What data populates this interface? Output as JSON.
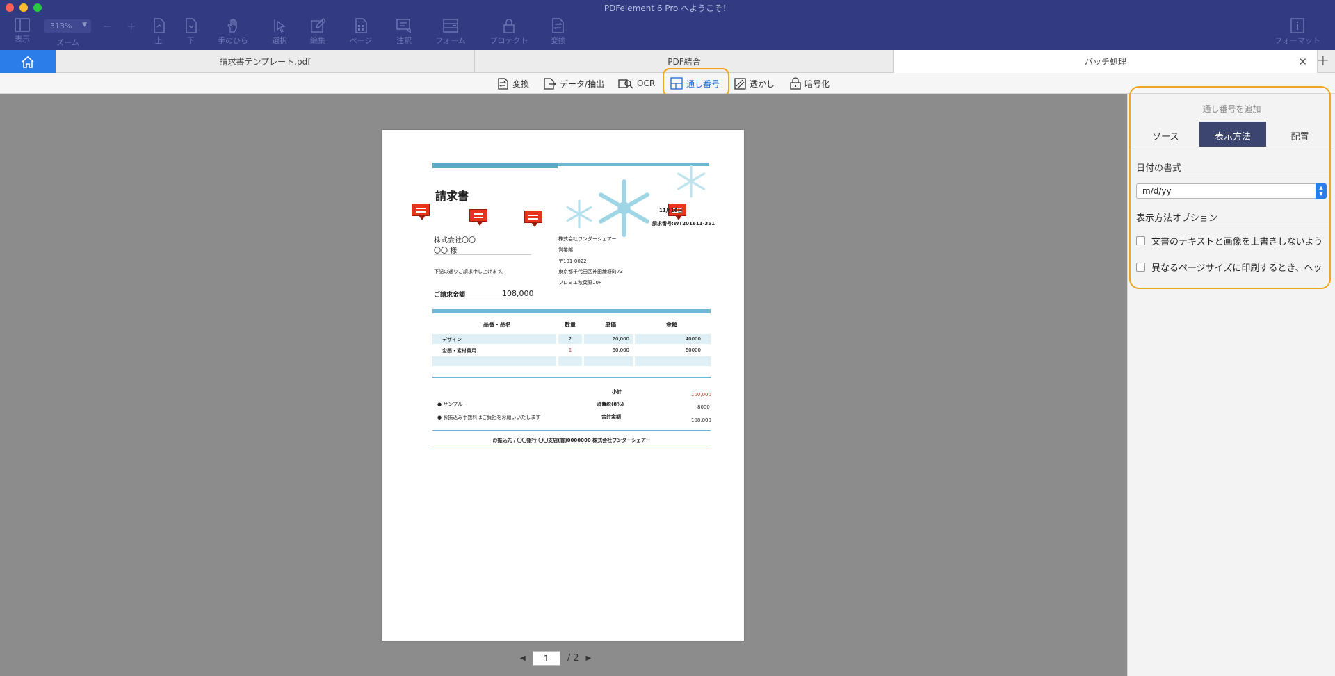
{
  "app": {
    "title": "PDFelement 6 Pro へようこそ！"
  },
  "colors": {
    "toolbar_bg": "#323b82",
    "accent_blue": "#2b7de9",
    "highlight": "#f0a520",
    "active_tab": "#3c4470"
  },
  "toolbar": {
    "zoom_value": "313%",
    "zoom_label": "ズーム",
    "tools": [
      {
        "label": "表示",
        "icon": "sidebar-icon"
      },
      {
        "label": "上",
        "icon": "page-up-icon"
      },
      {
        "label": "下",
        "icon": "page-down-icon"
      },
      {
        "label": "手のひら",
        "icon": "hand-icon"
      },
      {
        "label": "選択",
        "icon": "cursor-icon"
      },
      {
        "label": "編集",
        "icon": "edit-icon"
      },
      {
        "label": "ページ",
        "icon": "page-icon"
      },
      {
        "label": "注釈",
        "icon": "comment-icon"
      },
      {
        "label": "フォーム",
        "icon": "form-icon"
      },
      {
        "label": "プロテクト",
        "icon": "lock-icon"
      },
      {
        "label": "変換",
        "icon": "convert-icon"
      },
      {
        "label": "フォーマット",
        "icon": "info-icon"
      }
    ]
  },
  "tabs": {
    "doc1": "請求書テンプレート.pdf",
    "doc2": "PDF結合",
    "doc3": "バッチ処理"
  },
  "batch_toolbar": {
    "convert": "変換",
    "extract": "データ/抽出",
    "ocr": "OCR",
    "bates": "通し番号",
    "watermark": "透かし",
    "encrypt": "暗号化"
  },
  "document": {
    "title": "請求書",
    "date": "11月16日",
    "invoice_no": "請求番号:WT201611-351",
    "client_company": "株式会社〇〇",
    "client_name": "〇〇 様",
    "issuer_company": "株式会社ワンダーシェアー",
    "issuer_dept": "営業部",
    "issuer_zip": "〒101-0022",
    "issuer_address": "東京都千代田区神田練塀町73",
    "issuer_building": "プロミエ秋葉原10F",
    "intro": "下記の通りご請求申し上げます。",
    "amount_label": "ご請求金額",
    "amount_value": "108,000",
    "table_headers": [
      "品番・品名",
      "数量",
      "単価",
      "金額"
    ],
    "rows": [
      {
        "item": "デザイン",
        "qty": "2",
        "unit": "20,000",
        "amount": "40000"
      },
      {
        "item": "企画・素材費用",
        "qty": "1",
        "unit": "60,000",
        "amount": "60000"
      }
    ],
    "notes": [
      "サンプル",
      "お振込み手数料はご負担をお願いいたします"
    ],
    "subtotal_label": "小計",
    "subtotal_value": "100,000",
    "tax_label": "消費税(8%)",
    "tax_value": "8000",
    "total_label": "合計金額",
    "total_value": "108,000",
    "bank": "お振込先 / 〇〇銀行 〇〇支店(普)0000000 株式会社ワンダーシェアー"
  },
  "pager": {
    "current": "1",
    "total": "/ 2"
  },
  "panel": {
    "title": "通し番号を追加",
    "tabs": [
      "ソース",
      "表示方法",
      "配置"
    ],
    "active_tab": "表示方法",
    "date_format_label": "日付の書式",
    "date_format_value": "m/d/yy",
    "options_label": "表示方法オプション",
    "option1": "文書のテキストと画像を上書きしないよう",
    "option2": "異なるページサイズに印刷するとき、ヘッ"
  }
}
